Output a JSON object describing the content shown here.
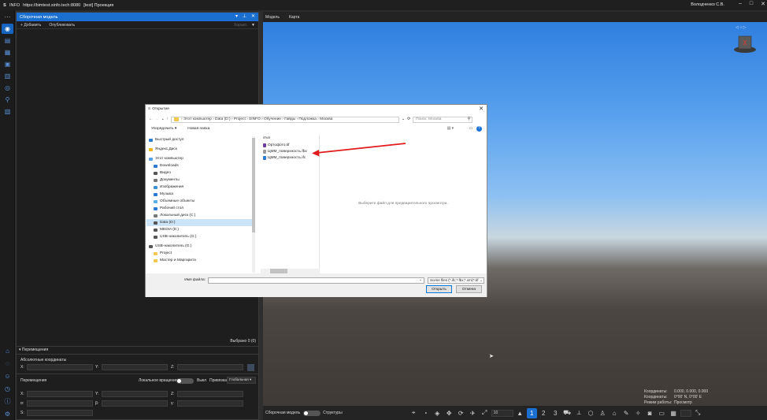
{
  "app": {
    "logo": "S",
    "name": "INFO",
    "url": "https://bimtest.sinfo.tech:8080",
    "title_suffix": "[test] Проекция",
    "user": "Володченко С.В."
  },
  "left_panel": {
    "title": "Сборочная модель",
    "add_label": "Добавить",
    "publish_label": "Опубликовать",
    "layers_label": "Характ.",
    "counter": "Выбрано 0 (0)",
    "movement_section": "Перемещения",
    "abs_coords_label": "Абсолютные координаты",
    "move_label": "Перемещения",
    "local_rotation_label": "Локальное вращение",
    "off_label": "Выкл",
    "snap_label": "Привязка",
    "snap_value": "Глобальная",
    "axes": {
      "x": "X:",
      "y": "Y:",
      "z": "Z:",
      "a": "α:",
      "b": "β:",
      "g": "γ:",
      "s": "S:"
    }
  },
  "viewport": {
    "tabs": [
      "Модель",
      "Карта"
    ],
    "bottom_left_label": "Сборочная модель",
    "structure_label": "Структуры",
    "page_field": "10",
    "pages": [
      "1",
      "2",
      "3"
    ],
    "coords": [
      {
        "label": "Координаты:",
        "value": "0.000, 0.000, 0.000"
      },
      {
        "label": "Координаты:",
        "value": "0°00' N, 0°00' E"
      },
      {
        "label": "Режим работы:",
        "value": "Просмотр"
      }
    ],
    "gizmo_label": "X"
  },
  "dialog": {
    "title": "Открытие",
    "breadcrumb": [
      "Этот компьютер",
      "Data (D:)",
      "Project",
      "SINFO",
      "Обучение",
      "Гайды",
      "Подложка",
      "Москва"
    ],
    "search_placeholder": "Поиск: Москва",
    "organize_label": "Упорядочить ▾",
    "new_folder_label": "Новая папка",
    "tree": [
      {
        "label": "Быстрый доступ",
        "icon": "star-icon",
        "color": "#2a7ad6"
      },
      {
        "label": "Яндекс.Диск",
        "icon": "cloud-icon",
        "color": "#f2b417"
      },
      {
        "label": "Этот компьютер",
        "icon": "computer-icon",
        "color": "#5aa0e6"
      },
      {
        "label": "Downloads",
        "icon": "download-icon",
        "color": "#2a7ad6"
      },
      {
        "label": "Видео",
        "icon": "video-icon",
        "color": "#555"
      },
      {
        "label": "Документы",
        "icon": "document-icon",
        "color": "#777"
      },
      {
        "label": "Изображения",
        "icon": "image-icon",
        "color": "#3d8fd6"
      },
      {
        "label": "Музыка",
        "icon": "music-icon",
        "color": "#2a7ad6"
      },
      {
        "label": "Объемные объекты",
        "icon": "cube-icon",
        "color": "#5ab0e6"
      },
      {
        "label": "Рабочий стол",
        "icon": "desktop-icon",
        "color": "#2a7ad6"
      },
      {
        "label": "Локальный диск (C:)",
        "icon": "drive-icon",
        "color": "#777"
      },
      {
        "label": "Data (D:)",
        "icon": "drive-icon",
        "color": "#555"
      },
      {
        "label": "MEDIA (E:)",
        "icon": "drive-icon",
        "color": "#555"
      },
      {
        "label": "USB-накопитель (G:)",
        "icon": "usb-icon",
        "color": "#555"
      },
      {
        "label": "USB-накопитель (G:)",
        "icon": "usb-icon",
        "color": "#555"
      },
      {
        "label": "Project",
        "icon": "folder-icon",
        "color": "#f2c94c"
      },
      {
        "label": "Мастер и Маргарита",
        "icon": "folder-icon",
        "color": "#f2c94c"
      }
    ],
    "files_header": "Имя",
    "files": [
      {
        "name": "Ортофото.tif",
        "icon": "image-file-icon",
        "color": "#6b3fa0"
      },
      {
        "name": "ЦММ_поверхность.fbx",
        "icon": "fbx-file-icon",
        "color": "#999"
      },
      {
        "name": "ЦММ_поверхность.ifc",
        "icon": "ifc-file-icon",
        "color": "#2a7ad6"
      }
    ],
    "preview_text": "Выберите файл для предварительного просмотра.",
    "filename_label": "Имя файла:",
    "filename_value": "",
    "filter_value": "Scene files (*.ifc;*.fbx;*.xml;*.tif",
    "open_label": "Открыть",
    "cancel_label": "Отмена"
  },
  "annotation": {
    "color": "#e11b1b"
  }
}
